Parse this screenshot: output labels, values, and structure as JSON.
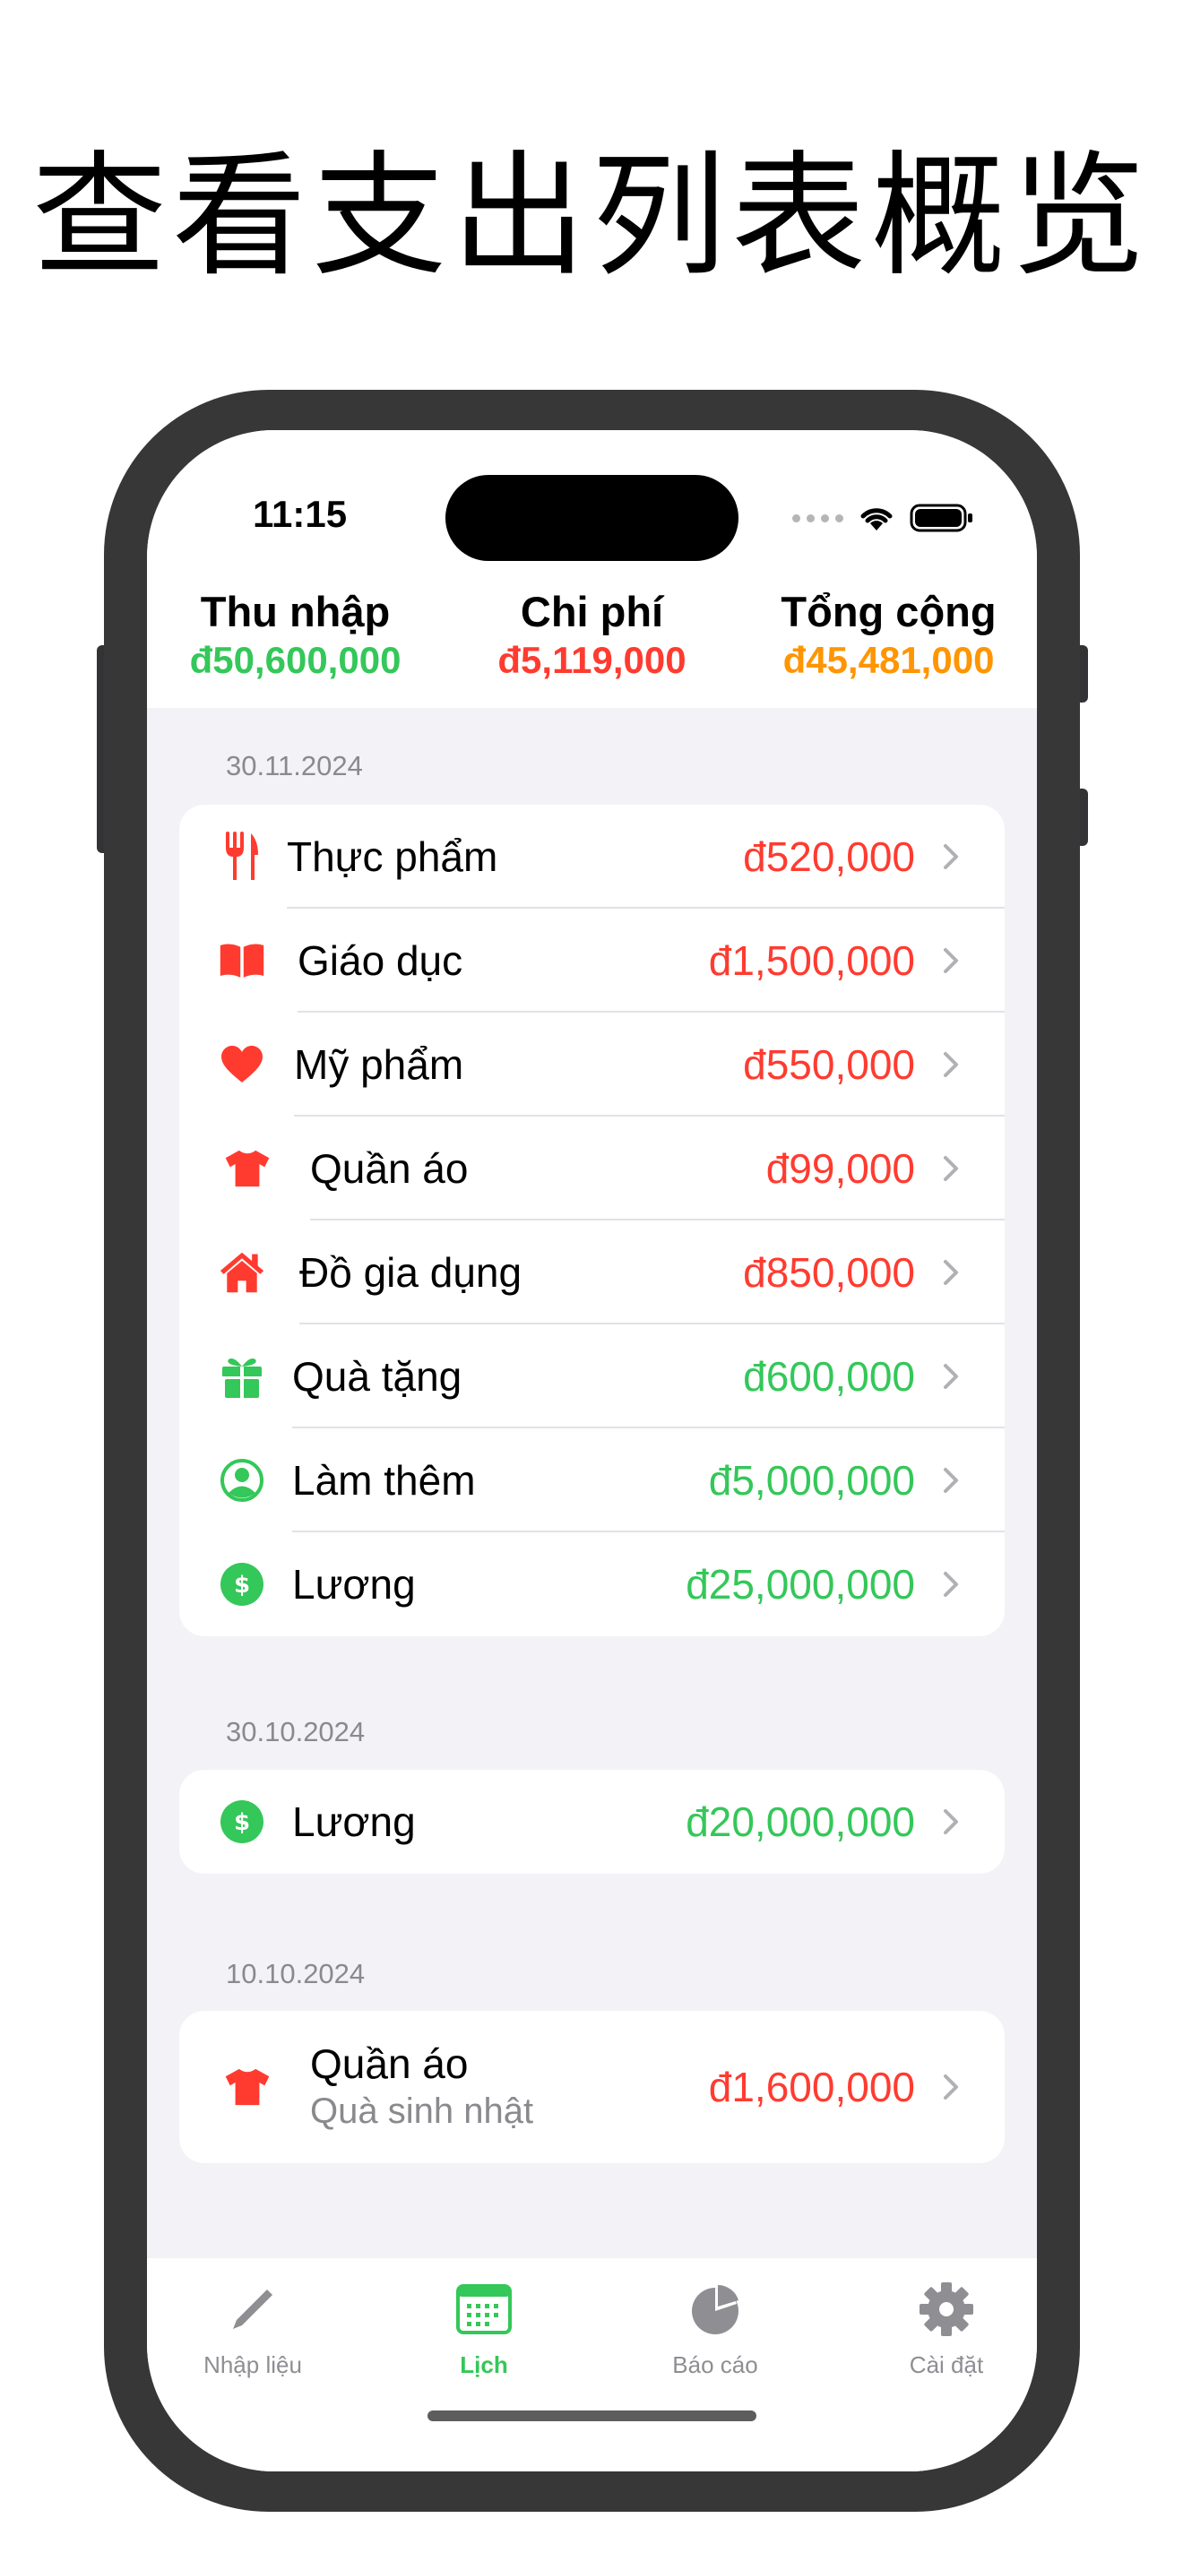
{
  "headline": "查看支出列表概览",
  "status": {
    "time": "11:15"
  },
  "summary": {
    "income_label": "Thu nhập",
    "income_value": "đ50,600,000",
    "expense_label": "Chi phí",
    "expense_value": "đ5,119,000",
    "total_label": "Tổng cộng",
    "total_value": "đ45,481,000"
  },
  "colors": {
    "income": "#34c759",
    "expense": "#ff3b30",
    "total": "#ff9500",
    "accent": "#34c759"
  },
  "groups": [
    {
      "date": "30.11.2024",
      "items": [
        {
          "label": "Thực phẩm",
          "amount": "đ520,000",
          "type": "expense",
          "icon": "fork-knife-icon"
        },
        {
          "label": "Giáo dục",
          "amount": "đ1,500,000",
          "type": "expense",
          "icon": "book-icon"
        },
        {
          "label": "Mỹ phẩm",
          "amount": "đ550,000",
          "type": "expense",
          "icon": "heart-icon"
        },
        {
          "label": "Quần áo",
          "amount": "đ99,000",
          "type": "expense",
          "icon": "tshirt-icon"
        },
        {
          "label": "Đồ gia dụng",
          "amount": "đ850,000",
          "type": "expense",
          "icon": "house-icon"
        },
        {
          "label": "Quà tặng",
          "amount": "đ600,000",
          "type": "income",
          "icon": "gift-icon"
        },
        {
          "label": "Làm thêm",
          "amount": "đ5,000,000",
          "type": "income",
          "icon": "person-circle-icon"
        },
        {
          "label": "Lương",
          "amount": "đ25,000,000",
          "type": "income",
          "icon": "dollar-circle-icon"
        }
      ]
    },
    {
      "date": "30.10.2024",
      "items": [
        {
          "label": "Lương",
          "amount": "đ20,000,000",
          "type": "income",
          "icon": "dollar-circle-icon"
        }
      ]
    },
    {
      "date": "10.10.2024",
      "items": [
        {
          "label": "Quần áo",
          "note": "Quà sinh nhật",
          "amount": "đ1,600,000",
          "type": "expense",
          "icon": "tshirt-icon"
        }
      ]
    }
  ],
  "tabs": [
    {
      "label": "Nhập liệu",
      "icon": "pencil-icon",
      "active": false
    },
    {
      "label": "Lịch",
      "icon": "calendar-icon",
      "active": true
    },
    {
      "label": "Báo cáo",
      "icon": "pie-chart-icon",
      "active": false
    },
    {
      "label": "Cài đặt",
      "icon": "gear-icon",
      "active": false
    }
  ]
}
